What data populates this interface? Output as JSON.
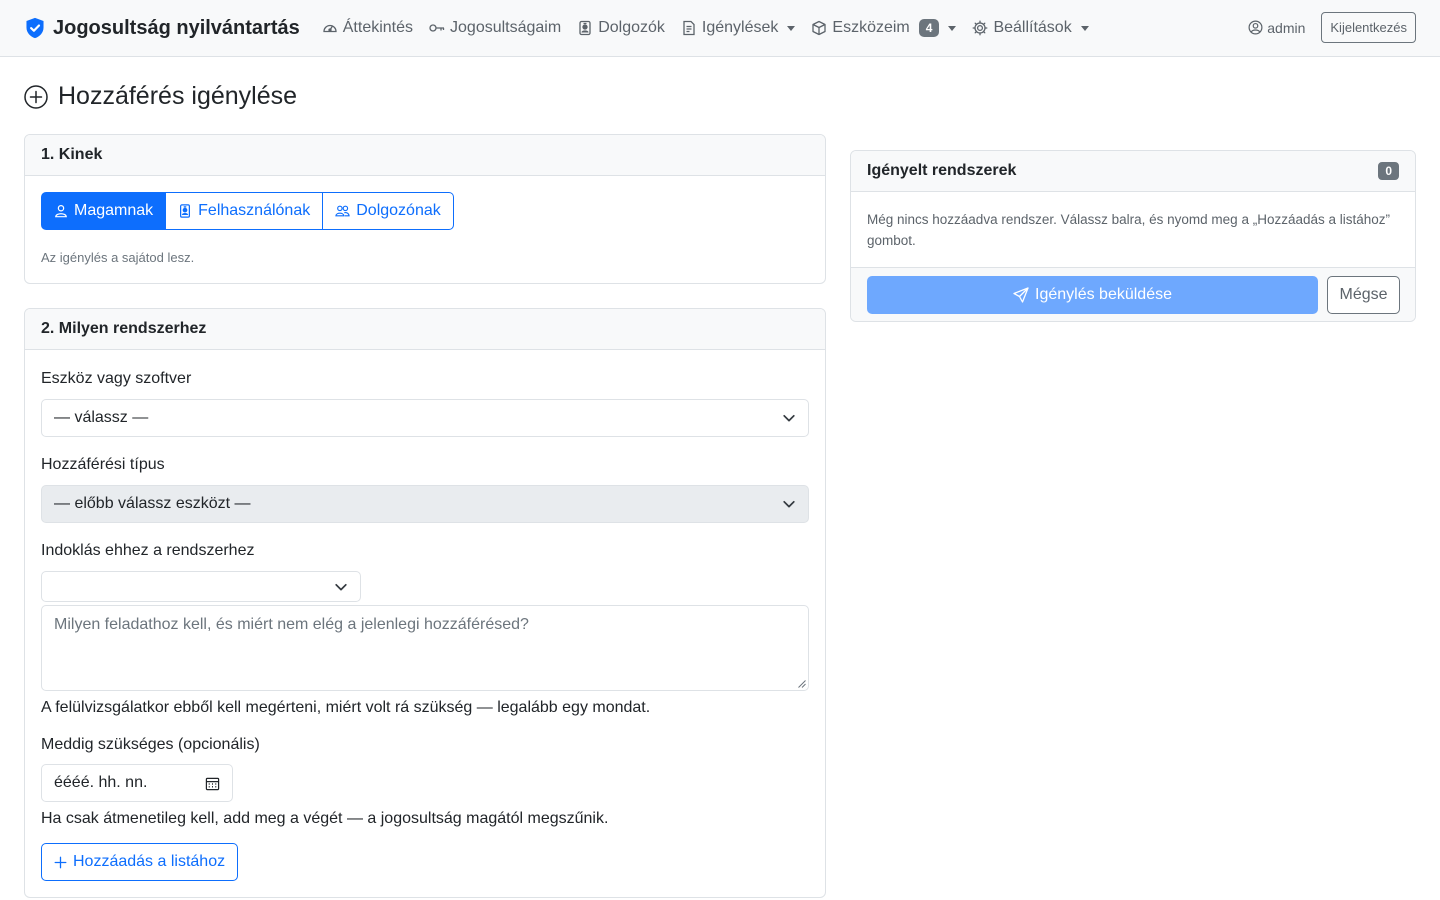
{
  "navbar": {
    "brand": "Jogosultság nyilvántartás",
    "items": [
      {
        "label": "Áttekintés",
        "icon": "speedometer-icon",
        "dropdown": false
      },
      {
        "label": "Jogosultságaim",
        "icon": "key-icon",
        "dropdown": false
      },
      {
        "label": "Dolgozók",
        "icon": "person-badge-icon",
        "dropdown": false
      },
      {
        "label": "Igénylések",
        "icon": "file-text-icon",
        "dropdown": true
      },
      {
        "label": "Eszközeim",
        "icon": "box-icon",
        "dropdown": true,
        "badge": "4"
      },
      {
        "label": "Beállítások",
        "icon": "gear-icon",
        "dropdown": true
      }
    ],
    "user": "admin",
    "logout": "Kijelentkezés"
  },
  "page": {
    "title": "Hozzáférés igénylése"
  },
  "kinek": {
    "header": "1. Kinek",
    "options": [
      "Magamnak",
      "Felhasználónak",
      "Dolgozónak"
    ],
    "selected": "Magamnak",
    "help": "Az igénylés a sajátod lesz."
  },
  "rendszer": {
    "header": "2. Milyen rendszerhez",
    "tool_label": "Eszköz vagy szoftver",
    "tool_value": "— válassz —",
    "access_label": "Hozzáférési típus",
    "access_value": "— előbb válassz eszközt —",
    "reason_label": "Indoklás ehhez a rendszerhez",
    "reason_select_value": "",
    "reason_placeholder": "Milyen feladathoz kell, és miért nem elég a jelenlegi hozzáférésed?",
    "reason_help": "A felülvizsgálatkor ebből kell megérteni, miért volt rá szükség — legalább egy mondat.",
    "until_label": "Meddig szükséges (opcionális)",
    "until_placeholder": "éééé. hh. nn.",
    "until_help": "Ha csak átmenetileg kell, add meg a végét — a jogosultság magától megszűnik.",
    "add_button": "Hozzáadás a listához"
  },
  "igenyelt": {
    "header": "Igényelt rendszerek",
    "count": "0",
    "empty": "Még nincs hozzáadva rendszer. Válassz balra, és nyomd meg a „Hozzáadás a listához” gombot.",
    "submit": "Igénylés beküldése",
    "cancel": "Mégse"
  },
  "colors": {
    "primary": "#0d6efd",
    "primary_light": "#6ea8fe",
    "secondary": "#6c757d",
    "border": "#dee2e6",
    "header_bg": "#f8f9fa"
  }
}
